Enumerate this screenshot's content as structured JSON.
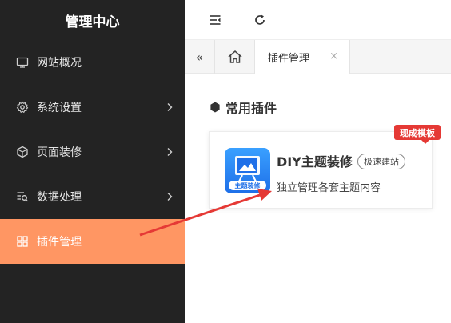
{
  "sidebar": {
    "title": "管理中心",
    "items": [
      {
        "label": "网站概况",
        "icon": "monitor-icon",
        "has_children": false,
        "active": false
      },
      {
        "label": "系统设置",
        "icon": "gear-icon",
        "has_children": true,
        "active": false
      },
      {
        "label": "页面装修",
        "icon": "cube-icon",
        "has_children": true,
        "active": false
      },
      {
        "label": "数据处理",
        "icon": "list-search-icon",
        "has_children": true,
        "active": false
      },
      {
        "label": "插件管理",
        "icon": "grid-icon",
        "has_children": false,
        "active": true
      }
    ],
    "colors": {
      "background": "#232323",
      "active": "#ff9663"
    }
  },
  "topbar": {
    "icons": [
      "collapse-menu-icon",
      "refresh-icon"
    ]
  },
  "tabs": {
    "active_label": "插件管理",
    "close_symbol": "×",
    "back_symbol": "«"
  },
  "main": {
    "section_title": "常用插件",
    "card": {
      "title": "DIY主题装修",
      "tag": "极速建站",
      "description": "独立管理各套主题内容",
      "badge": "现成模板",
      "thumb_caption": "主题装修",
      "thumb_color": "#1e6fe8"
    }
  },
  "annotation": {
    "arrow_color": "#e53935"
  }
}
